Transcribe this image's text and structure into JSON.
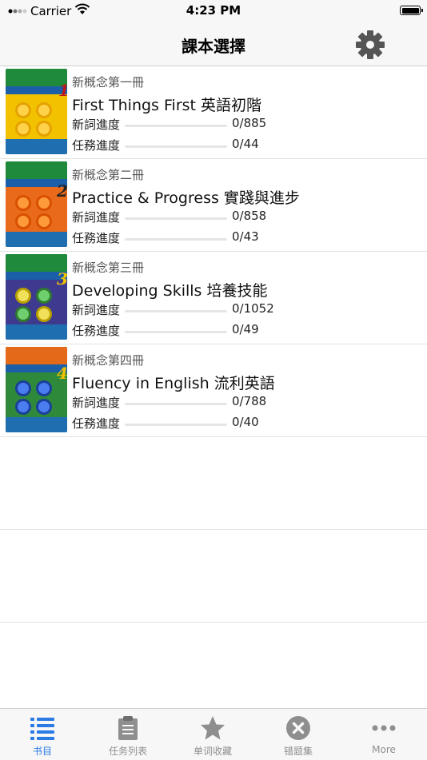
{
  "status": {
    "carrier": "Carrier",
    "time": "4:23 PM"
  },
  "nav": {
    "title": "課本選擇",
    "settings_icon": "gear-icon"
  },
  "books": [
    {
      "series": "新概念第一冊",
      "title": "First Things First 英語初階",
      "words_label": "新詞進度",
      "words_value": "0/885",
      "words_progress": 0,
      "tasks_label": "任務進度",
      "tasks_value": "0/44",
      "tasks_progress": 0,
      "cover_number": "1",
      "cover_color": "#f2c200"
    },
    {
      "series": "新概念第二冊",
      "title": "Practice & Progress 實踐與進步",
      "words_label": "新詞進度",
      "words_value": "0/858",
      "words_progress": 0,
      "tasks_label": "任務進度",
      "tasks_value": "0/43",
      "tasks_progress": 0,
      "cover_number": "2",
      "cover_color": "#e86a1a"
    },
    {
      "series": "新概念第三冊",
      "title": "Developing Skills 培養技能",
      "words_label": "新詞進度",
      "words_value": "0/1052",
      "words_progress": 0,
      "tasks_label": "任務進度",
      "tasks_value": "0/49",
      "tasks_progress": 0,
      "cover_number": "3",
      "cover_color": "#3d3a8f"
    },
    {
      "series": "新概念第四冊",
      "title": "Fluency in English 流利英語",
      "words_label": "新詞進度",
      "words_value": "0/788",
      "words_progress": 0,
      "tasks_label": "任務進度",
      "tasks_value": "0/40",
      "tasks_progress": 0,
      "cover_number": "4",
      "cover_color": "#2e8a3a"
    }
  ],
  "tabs": [
    {
      "label": "书目",
      "icon": "list-icon",
      "active": true
    },
    {
      "label": "任务列表",
      "icon": "clipboard-icon",
      "active": false
    },
    {
      "label": "单词收藏",
      "icon": "star-icon",
      "active": false
    },
    {
      "label": "错题集",
      "icon": "close-circle-icon",
      "active": false
    },
    {
      "label": "More",
      "icon": "more-icon",
      "active": false
    }
  ],
  "colors": {
    "accent": "#2a7be4",
    "tab_inactive": "#8e8e8e",
    "bar_bg": "#f7f7f7"
  }
}
